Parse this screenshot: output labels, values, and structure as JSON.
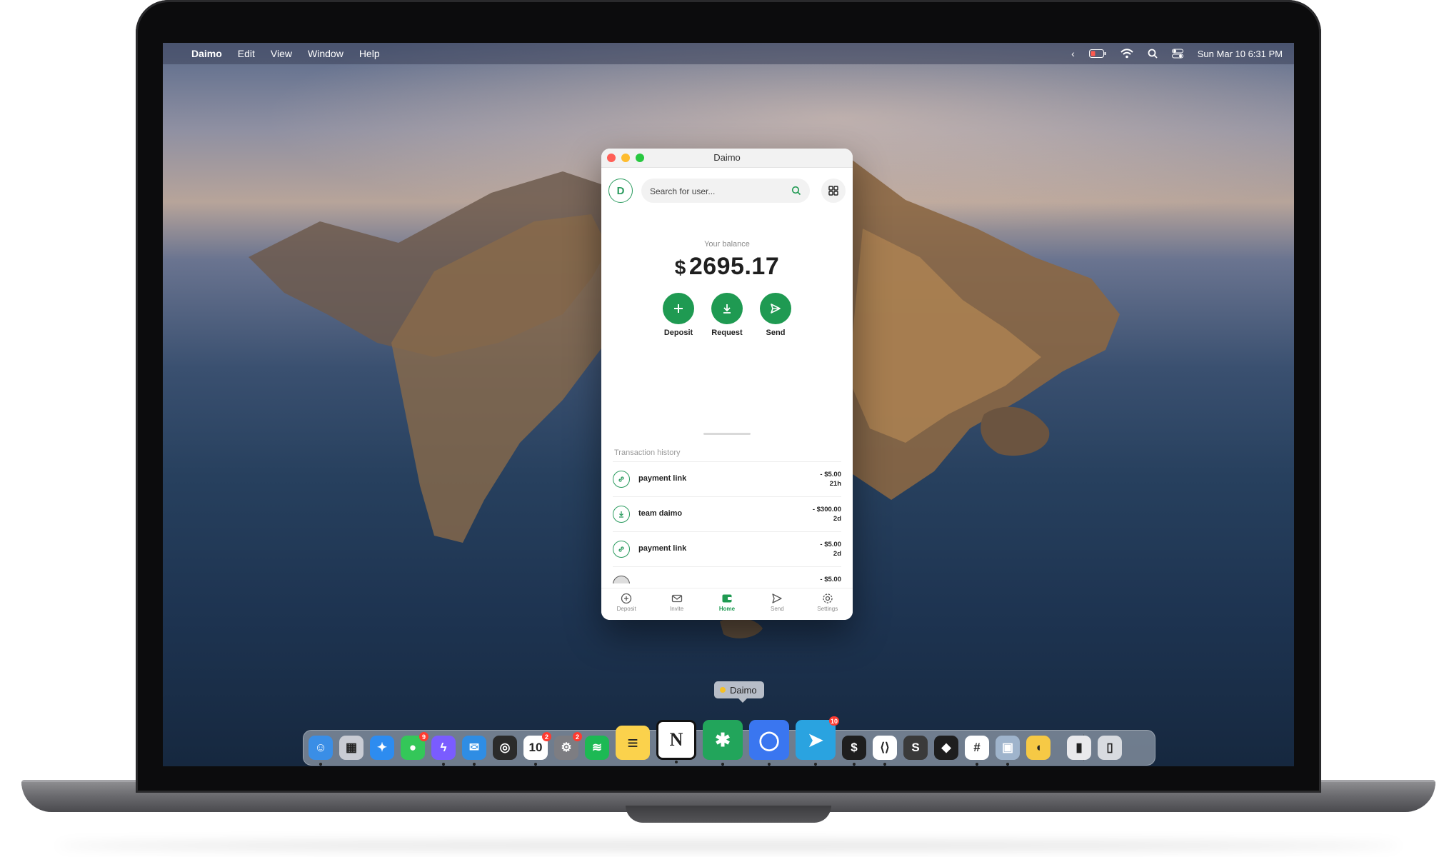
{
  "menubar": {
    "app_name": "Daimo",
    "menus": [
      "Edit",
      "View",
      "Window",
      "Help"
    ],
    "clock": "Sun Mar 10  6:31 PM"
  },
  "window": {
    "title": "Daimo",
    "avatar_letter": "D",
    "search_placeholder": "Search for user...",
    "balance_label": "Your balance",
    "balance_currency": "$",
    "balance_value": "2695.17",
    "actions": [
      "Deposit",
      "Request",
      "Send"
    ],
    "tx_title": "Transaction history",
    "transactions": [
      {
        "name": "payment link",
        "amount": "- $5.00",
        "age": "21h",
        "icon": "link-icon"
      },
      {
        "name": "team daimo",
        "amount": "- $300.00",
        "age": "2d",
        "icon": "download-icon"
      },
      {
        "name": "payment link",
        "amount": "- $5.00",
        "age": "2d",
        "icon": "link-icon"
      },
      {
        "name": "...",
        "amount": "- $5.00",
        "age": "",
        "icon": "avatar-icon"
      }
    ],
    "tabs": [
      {
        "label": "Deposit",
        "active": false
      },
      {
        "label": "Invite",
        "active": false
      },
      {
        "label": "Home",
        "active": true
      },
      {
        "label": "Send",
        "active": false
      },
      {
        "label": "Settings",
        "active": false
      }
    ],
    "accent": "#1f9a52"
  },
  "dock": {
    "tooltip": "Daimo",
    "apps": [
      {
        "name": "Finder",
        "icon": "finder-icon",
        "color": "#3a8ee6",
        "glyph": "☺"
      },
      {
        "name": "Launchpad",
        "icon": "launchpad-icon",
        "color": "#c9ccd4",
        "glyph": "▦"
      },
      {
        "name": "Safari",
        "icon": "safari-icon",
        "color": "#2d8cf0",
        "glyph": "✦"
      },
      {
        "name": "Messages",
        "icon": "messages-icon",
        "color": "#34c759",
        "glyph": "●",
        "badge": "9"
      },
      {
        "name": "Messenger",
        "icon": "messenger-icon",
        "color": "#7a5cff",
        "glyph": "ϟ"
      },
      {
        "name": "Mail",
        "icon": "mail-icon",
        "color": "#2f8de4",
        "glyph": "✉"
      },
      {
        "name": "Loom",
        "icon": "loom-icon",
        "color": "#2b2b2b",
        "glyph": "◎"
      },
      {
        "name": "Calendar",
        "icon": "calendar-icon",
        "color": "#ffffff",
        "glyph": "10",
        "badge": "2"
      },
      {
        "name": "System Preferences",
        "icon": "gear-icon",
        "color": "#7d7d82",
        "glyph": "⚙",
        "badge": "2"
      },
      {
        "name": "Spotify",
        "icon": "spotify-icon",
        "color": "#1db954",
        "glyph": "≋"
      },
      {
        "name": "Notes",
        "icon": "notes-icon",
        "color": "#fbd24c",
        "glyph": "≡"
      },
      {
        "name": "Notion",
        "icon": "notion-icon",
        "color": "#ffffff",
        "glyph": "N"
      },
      {
        "name": "Daimo",
        "icon": "daimo-icon",
        "color": "#22a55b",
        "glyph": "✱"
      },
      {
        "name": "Signal",
        "icon": "signal-icon",
        "color": "#3a76f0",
        "glyph": "◯"
      },
      {
        "name": "Telegram",
        "icon": "telegram-icon",
        "color": "#2aa3e0",
        "glyph": "➤",
        "badge": "10"
      },
      {
        "name": "Terminal",
        "icon": "terminal-icon",
        "color": "#1e1e1e",
        "glyph": "$"
      },
      {
        "name": "VS Code",
        "icon": "vscode-icon",
        "color": "#ffffff",
        "glyph": "⟨⟩"
      },
      {
        "name": "Sublime Text",
        "icon": "sublime-icon",
        "color": "#3a3a3a",
        "glyph": "S"
      },
      {
        "name": "Figma",
        "icon": "figma-icon",
        "color": "#1e1e1e",
        "glyph": "◆"
      },
      {
        "name": "Slack",
        "icon": "slack-icon",
        "color": "#ffffff",
        "glyph": "#"
      },
      {
        "name": "Preview",
        "icon": "preview-icon",
        "color": "#9fb4cc",
        "glyph": "▣"
      },
      {
        "name": "Cyberduck",
        "icon": "cyberduck-icon",
        "color": "#f6c945",
        "glyph": "◖"
      },
      {
        "name": "Archive",
        "icon": "archive-icon",
        "color": "#e9e9ec",
        "glyph": "▮"
      },
      {
        "name": "Trash",
        "icon": "trash-icon",
        "color": "#d8dbe0",
        "glyph": "▯"
      }
    ]
  }
}
